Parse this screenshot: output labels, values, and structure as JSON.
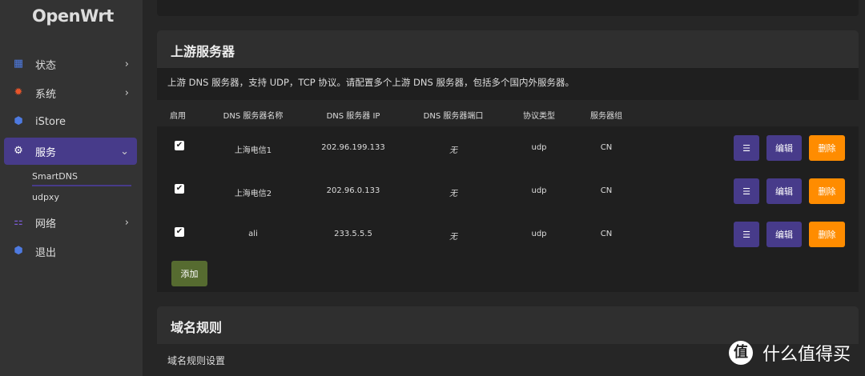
{
  "logo": "OpenWrt",
  "sidebar": {
    "items": [
      {
        "label": "状态",
        "icon": "dashboard-icon",
        "color": "#4e7ae0"
      },
      {
        "label": "系统",
        "icon": "gear-icon",
        "color": "#e8552a"
      },
      {
        "label": "iStore",
        "icon": "cube-icon",
        "color": "#4e7ae0"
      },
      {
        "label": "服务",
        "icon": "cogs-icon",
        "color": "#ffffff"
      },
      {
        "label": "网络",
        "icon": "network-icon",
        "color": "#7b5cd6"
      },
      {
        "label": "退出",
        "icon": "cube-icon",
        "color": "#4e7ae0"
      }
    ],
    "sub": [
      "SmartDNS",
      "udpxy"
    ]
  },
  "upstream": {
    "title": "上游服务器",
    "description": "上游 DNS 服务器，支持 UDP，TCP 协议。请配置多个上游 DNS 服务器，包括多个国内外服务器。",
    "columns": [
      "启用",
      "DNS 服务器名称",
      "DNS 服务器 IP",
      "DNS 服务器端口",
      "协议类型",
      "服务器组"
    ],
    "rows": [
      {
        "enabled": true,
        "name": "上海电信1",
        "ip": "202.96.199.133",
        "port": "无",
        "protocol": "udp",
        "group": "CN"
      },
      {
        "enabled": true,
        "name": "上海电信2",
        "ip": "202.96.0.133",
        "port": "无",
        "protocol": "udp",
        "group": "CN"
      },
      {
        "enabled": true,
        "name": "ali",
        "ip": "233.5.5.5",
        "port": "无",
        "protocol": "udp",
        "group": "CN"
      }
    ],
    "sort_label": "☰",
    "edit_label": "编辑",
    "delete_label": "删除",
    "add_label": "添加"
  },
  "domain": {
    "title": "域名规则",
    "subtitle": "域名规则设置"
  },
  "watermark": {
    "badge": "值",
    "text": "什么值得买"
  }
}
